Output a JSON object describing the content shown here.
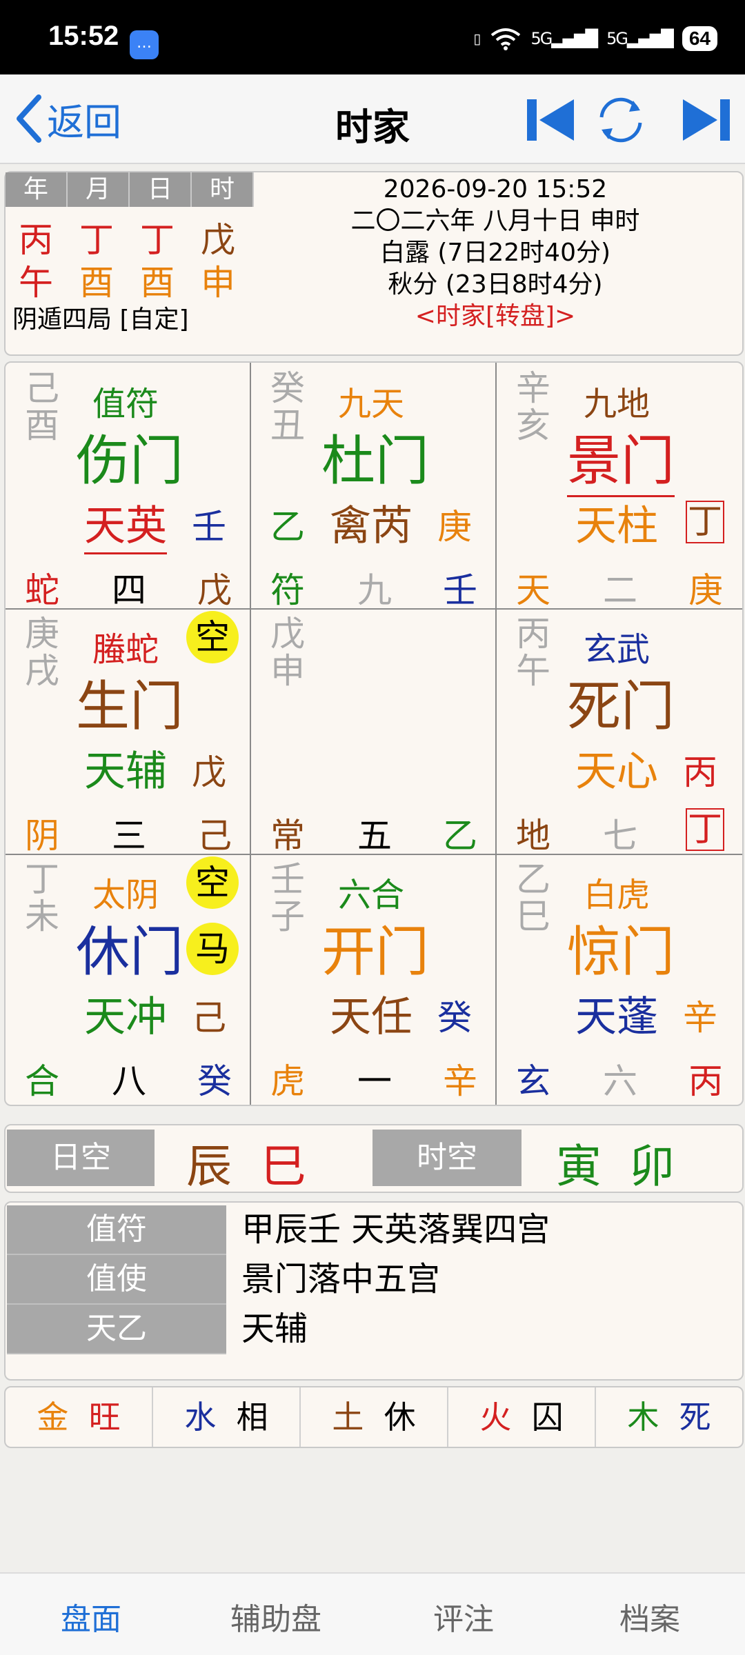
{
  "status_bar": {
    "time": "15:52",
    "network": "5G",
    "battery": "64"
  },
  "nav": {
    "back_label": "返回",
    "title": "时家"
  },
  "colors": {
    "red": "#d42020",
    "orange": "#e8820c",
    "green": "#1b8a1b",
    "brown": "#8b4513",
    "blue": "#1a2f9e",
    "gray": "#aaaaaa",
    "accent": "#1f6fd6"
  },
  "pillars": {
    "headers": [
      "年",
      "月",
      "日",
      "时"
    ],
    "stems": [
      "丙",
      "丁",
      "丁",
      "戊"
    ],
    "branches": [
      "午",
      "酉",
      "酉",
      "申"
    ]
  },
  "ju": "阴遁四局 [自定]",
  "dates": {
    "gregorian": "2026-09-20 15:52",
    "lunar": "二〇二六年 八月十日 申时",
    "term1": "白露 (7日22时40分)",
    "term2": "秋分 (23日8时4分)",
    "mode": "<时家[转盘]>"
  },
  "palaces": [
    {
      "gz": "己酉",
      "god": "值符",
      "door": "伤门",
      "star": "天英",
      "stem": "壬",
      "bottom": [
        "蛇",
        "四",
        "戊"
      ]
    },
    {
      "gz": "癸丑",
      "god": "九天",
      "door": "杜门",
      "star": "禽芮",
      "stem": "庚",
      "star_prefix": "乙",
      "bottom": [
        "符",
        "九",
        "壬"
      ]
    },
    {
      "gz": "辛亥",
      "god": "九地",
      "door": "景门",
      "star": "天柱",
      "stem": "丁",
      "bottom": [
        "天",
        "二",
        "庚"
      ]
    },
    {
      "gz": "庚戌",
      "god": "螣蛇",
      "badge": "空",
      "door": "生门",
      "star": "天辅",
      "stem": "戊",
      "bottom": [
        "阴",
        "三",
        "己"
      ]
    },
    {
      "gz": "戊申",
      "bottom": [
        "常",
        "五",
        "乙"
      ]
    },
    {
      "gz": "丙午",
      "god": "玄武",
      "door": "死门",
      "star": "天心",
      "stem": "丙",
      "bottom": [
        "地",
        "七",
        "丁"
      ]
    },
    {
      "gz": "丁未",
      "god": "太阴",
      "badge": "空",
      "badge2": "马",
      "door": "休门",
      "star": "天冲",
      "stem": "己",
      "bottom": [
        "合",
        "八",
        "癸"
      ]
    },
    {
      "gz": "壬子",
      "god": "六合",
      "door": "开门",
      "star": "天任",
      "stem": "癸",
      "bottom": [
        "虎",
        "一",
        "辛"
      ]
    },
    {
      "gz": "乙巳",
      "god": "白虎",
      "door": "惊门",
      "star": "天蓬",
      "stem": "辛",
      "bottom": [
        "玄",
        "六",
        "丙"
      ]
    }
  ],
  "kong": {
    "ri_label": "日空",
    "ri_1": "辰",
    "ri_2": "巳",
    "shi_label": "时空",
    "shi_1": "寅",
    "shi_2": "卯"
  },
  "zhifu": [
    {
      "label": "值符",
      "value": "甲辰壬  天英落巽四宫"
    },
    {
      "label": "值使",
      "value": "景门落中五宫"
    },
    {
      "label": "天乙",
      "value": "天辅"
    }
  ],
  "wuxing": [
    {
      "el": "金",
      "state": "旺"
    },
    {
      "el": "水",
      "state": "相"
    },
    {
      "el": "土",
      "state": "休"
    },
    {
      "el": "火",
      "state": "囚"
    },
    {
      "el": "木",
      "state": "死"
    }
  ],
  "tabs": [
    "盘面",
    "辅助盘",
    "评注",
    "档案"
  ]
}
